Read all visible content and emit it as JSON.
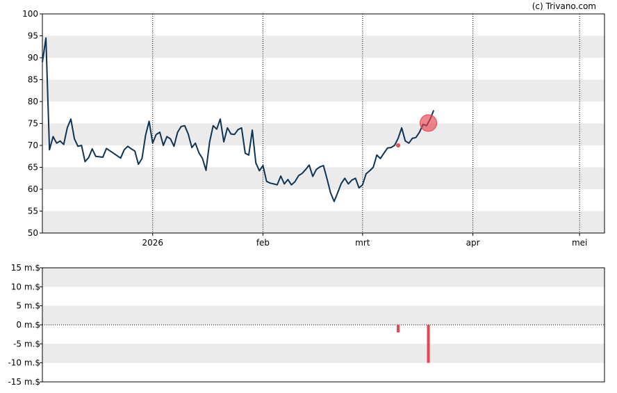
{
  "credit": "(c) Trivano.com",
  "colors": {
    "band": "#ebebeb",
    "line": "#0d3352",
    "marker": "#e8434f",
    "bar": "#e8434f",
    "grid": "#000000"
  },
  "chart_data": [
    {
      "type": "line",
      "title": "",
      "ylim": [
        50,
        100
      ],
      "y_ticks": [
        50,
        55,
        60,
        65,
        70,
        75,
        80,
        85,
        90,
        95,
        100
      ],
      "x_ticks": [
        {
          "label": "2026",
          "x": 23
        },
        {
          "label": "feb",
          "x": 54
        },
        {
          "label": "mrt",
          "x": 82
        },
        {
          "label": "apr",
          "x": 113
        },
        {
          "label": "mei",
          "x": 143
        }
      ],
      "xlim": [
        -8,
        150
      ],
      "grid": "dotted vertical at month ticks; alternating horizontal bands",
      "series": [
        {
          "values": [
            [
              -8,
              89
            ],
            [
              -7,
              94.5
            ],
            [
              -6,
              69
            ],
            [
              -5,
              72
            ],
            [
              -4,
              70.5
            ],
            [
              -3,
              71
            ],
            [
              -2,
              70.2
            ],
            [
              -1,
              74
            ],
            [
              0,
              76
            ],
            [
              1,
              71.5
            ],
            [
              2,
              69.8
            ],
            [
              3,
              70
            ],
            [
              4,
              66.3
            ],
            [
              5,
              67.2
            ],
            [
              6,
              69.2
            ],
            [
              7,
              67.5
            ],
            [
              9,
              67.3
            ],
            [
              10,
              69.3
            ],
            [
              12,
              68.2
            ],
            [
              14,
              67.1
            ],
            [
              15,
              69
            ],
            [
              16,
              69.8
            ],
            [
              17,
              69.2
            ],
            [
              18,
              68.7
            ],
            [
              19,
              65.7
            ],
            [
              20,
              67
            ],
            [
              21,
              72.3
            ],
            [
              22,
              75.5
            ],
            [
              23,
              70.5
            ],
            [
              24,
              72.5
            ],
            [
              25,
              73
            ],
            [
              26,
              70
            ],
            [
              27,
              72
            ],
            [
              28,
              71.5
            ],
            [
              29,
              69.8
            ],
            [
              30,
              73
            ],
            [
              31,
              74.3
            ],
            [
              32,
              74.5
            ],
            [
              33,
              72.6
            ],
            [
              34,
              69.5
            ],
            [
              35,
              70.5
            ],
            [
              36,
              68.3
            ],
            [
              37,
              67
            ],
            [
              38,
              64.3
            ],
            [
              39,
              70.8
            ],
            [
              40,
              74.5
            ],
            [
              41,
              73.7
            ],
            [
              42,
              76
            ],
            [
              43,
              70.8
            ],
            [
              44,
              74
            ],
            [
              45,
              72.6
            ],
            [
              46,
              72.5
            ],
            [
              47,
              73.6
            ],
            [
              48,
              74
            ],
            [
              49,
              68.2
            ],
            [
              50,
              67.8
            ],
            [
              51,
              73.5
            ],
            [
              52,
              66
            ],
            [
              53,
              64.2
            ],
            [
              54,
              65.4
            ],
            [
              55,
              61.8
            ],
            [
              56,
              61.4
            ],
            [
              57,
              61.2
            ],
            [
              58,
              61
            ],
            [
              59,
              63
            ],
            [
              60,
              61.2
            ],
            [
              61,
              62.2
            ],
            [
              62,
              61
            ],
            [
              63,
              61.7
            ],
            [
              64,
              63.1
            ],
            [
              65,
              63.6
            ],
            [
              66,
              64.5
            ],
            [
              67,
              65.5
            ],
            [
              68,
              62.9
            ],
            [
              69,
              64.5
            ],
            [
              70,
              65.1
            ],
            [
              71,
              65.4
            ],
            [
              72,
              62.4
            ],
            [
              73,
              59.2
            ],
            [
              74,
              57.2
            ],
            [
              75,
              59.2
            ],
            [
              76,
              61.3
            ],
            [
              77,
              62.5
            ],
            [
              78,
              61.2
            ],
            [
              79,
              62.1
            ],
            [
              80,
              62.5
            ],
            [
              81,
              60.3
            ],
            [
              82,
              61
            ],
            [
              83,
              63.5
            ],
            [
              84,
              64.2
            ],
            [
              85,
              65
            ],
            [
              86,
              67.8
            ],
            [
              87,
              67
            ],
            [
              88,
              68.2
            ],
            [
              89,
              69.4
            ],
            [
              90,
              69.5
            ],
            [
              91,
              70
            ],
            [
              92,
              71.6
            ],
            [
              93,
              74
            ],
            [
              94,
              71
            ],
            [
              95,
              70.5
            ],
            [
              96,
              71.6
            ],
            [
              97,
              71.8
            ],
            [
              98,
              73
            ],
            [
              99,
              74.8
            ],
            [
              100,
              74.5
            ],
            [
              101,
              76
            ],
            [
              102,
              78
            ]
          ]
        }
      ],
      "markers": [
        {
          "x": 92,
          "y": 70,
          "size": "small"
        },
        {
          "x": 100.5,
          "y": 75.1,
          "size": "large"
        }
      ]
    },
    {
      "type": "bar",
      "title": "",
      "ylim": [
        -15,
        15
      ],
      "y_ticks": [
        {
          "value": 15,
          "label": "15 m.$"
        },
        {
          "value": 10,
          "label": "10 m.$"
        },
        {
          "value": 5,
          "label": "5 m.$"
        },
        {
          "value": 0,
          "label": "0 m.$"
        },
        {
          "value": -5,
          "label": "-5 m.$"
        },
        {
          "value": -10,
          "label": "-10 m.$"
        },
        {
          "value": -15,
          "label": "-15 m.$"
        }
      ],
      "xlim": [
        -8,
        150
      ],
      "bars": [
        {
          "x": 92,
          "value": -2
        },
        {
          "x": 100.5,
          "value": -10
        }
      ]
    }
  ]
}
